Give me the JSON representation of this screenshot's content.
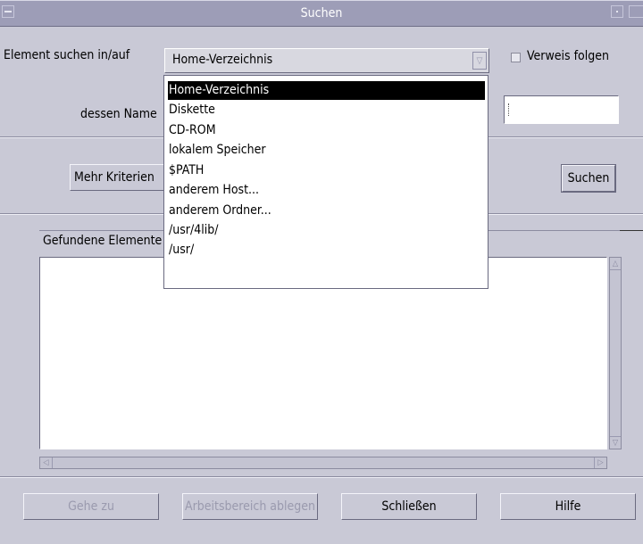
{
  "window": {
    "title": "Suchen"
  },
  "form": {
    "search_in_label": "Element suchen in/auf",
    "location_value": "Home-Verzeichnis",
    "follow_links_label": "Verweis folgen",
    "follow_links_checked": false,
    "name_label": "dessen Name",
    "name_value": ""
  },
  "dropdown": {
    "options": [
      "Home-Verzeichnis",
      "Diskette",
      "CD-ROM",
      "lokalem Speicher",
      "$PATH",
      "anderem Host...",
      "anderem Ordner...",
      "/usr/4lib/",
      "/usr/"
    ],
    "selected_index": 0
  },
  "buttons": {
    "more_criteria": "Mehr Kriterien",
    "search": "Suchen",
    "goto": "Gehe zu",
    "workspace": "Arbeitsbereich ablegen",
    "close": "Schließen",
    "help": "Hilfe"
  },
  "results": {
    "label": "Gefundene Elemente",
    "items": []
  }
}
